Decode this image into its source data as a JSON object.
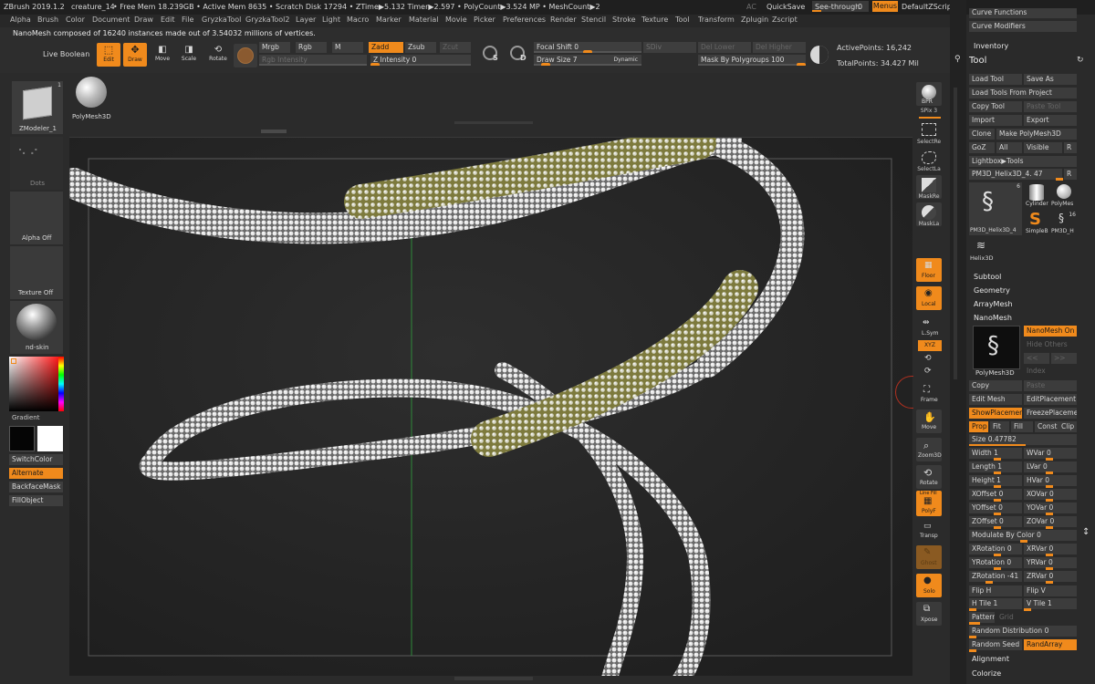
{
  "titlebar": {
    "app": "ZBrush 2019.1.2",
    "document": "creature_14",
    "stats": "• Free Mem 18.239GB • Active Mem 8635 • Scratch Disk 17294 • ZTime▶5.132 Timer▶2.597 • PolyCount▶3.524 MP • MeshCount▶2",
    "ac": "AC",
    "quicksave": "QuickSave",
    "seethrough": "See-through",
    "seethrough_value": "0",
    "menus": "Menus",
    "default_zscript": "DefaultZScript"
  },
  "menubar": [
    "Alpha",
    "Brush",
    "Color",
    "Document",
    "Draw",
    "Edit",
    "File",
    "GryzkaTool",
    "GryzkaTool2",
    "Layer",
    "Light",
    "Macro",
    "Marker",
    "Material",
    "Movie",
    "Picker",
    "Preferences",
    "Render",
    "Stencil",
    "Stroke",
    "Texture",
    "Tool",
    "Transform",
    "Zplugin",
    "Zscript"
  ],
  "notice": "NanoMesh composed of 16240 instances made out of 3.54032 millions of vertices.",
  "topshelf": {
    "live_boolean": "Live Boolean",
    "edit": "Edit",
    "draw": "Draw",
    "move": "Move",
    "scale": "Scale",
    "rotate": "Rotate",
    "mrgb": "Mrgb",
    "rgb": "Rgb",
    "m": "M",
    "zadd": "Zadd",
    "zsub": "Zsub",
    "zcut": "Zcut",
    "rgb_intensity": "Rgb Intensity",
    "z_intensity": "Z Intensity 0",
    "focal_shift": "Focal Shift 0",
    "draw_size": "Draw Size 7",
    "dynamic": "Dynamic",
    "sdiv": "SDiv",
    "del_lower": "Del Lower",
    "del_higher": "Del Higher",
    "mask_by_polygroups": "Mask By Polygroups 100",
    "active_points": "ActivePoints: 16,242",
    "total_points": "TotalPoints: 34.427 Mil"
  },
  "leftshelf": {
    "tool_label": "ZModeler_1",
    "polymesh_label": "PolyMesh3D",
    "dots": "Dots",
    "alpha_off": "Alpha Off",
    "texture_off": "Texture Off",
    "material": "nd-skin",
    "gradient": "Gradient",
    "switchcolor": "SwitchColor",
    "alternate": "Alternate",
    "backfacemask": "BackfaceMask",
    "fillobject": "FillObject",
    "tool_count": "1"
  },
  "rightshelf": {
    "bpr": "BPR",
    "spix": "SPix 3",
    "selectrect": "SelectRe",
    "selectlasso": "SelectLa",
    "maskrect": "MaskRe",
    "masklasso": "MaskLa",
    "floor": "Floor",
    "local": "Local",
    "lsym": "L.Sym",
    "xyz": "XYZ",
    "frame": "Frame",
    "move": "Move",
    "zoom3d": "Zoom3D",
    "rotate": "Rotate",
    "polyf": "PolyF",
    "linefill": "Line Fill",
    "transp": "Transp",
    "ghost": "Ghost",
    "solo": "Solo",
    "xpose": "Xpose"
  },
  "toolpanel": {
    "curve_functions": "Curve Functions",
    "curve_modifiers": "Curve Modifiers",
    "inventory": "Inventory",
    "tool_title": "Tool",
    "load_tool": "Load Tool",
    "save_as": "Save As",
    "load_from_project": "Load Tools From Project",
    "copy_tool": "Copy Tool",
    "paste_tool": "Paste Tool",
    "import": "Import",
    "export": "Export",
    "clone": "Clone",
    "make_polymesh": "Make PolyMesh3D",
    "goz": "GoZ",
    "all": "All",
    "visible": "Visible",
    "r": "R",
    "lightbox_tools": "Lightbox▶Tools",
    "current_tool": "PM3D_Helix3D_4. 47",
    "thumb_count": "6",
    "thumb_count2": "16",
    "thumbs": [
      "PM3D_Helix3D_4",
      "Cylinder",
      "PolyMes",
      "SimpleB",
      "PM3D_H",
      "Helix3D"
    ],
    "subtool": "Subtool",
    "geometry": "Geometry",
    "arraymesh": "ArrayMesh",
    "nanomesh": "NanoMesh",
    "nanomesh_on": "NanoMesh On",
    "hide_others": "Hide Others",
    "prev": "<<",
    "next": ">>",
    "index": "Index",
    "nm_thumb": "PolyMesh3D",
    "copy": "Copy",
    "paste": "Paste",
    "edit_mesh": "Edit Mesh",
    "edit_placement": "EditPlacement",
    "show_placement": "ShowPlacement",
    "freeze_placement": "FreezePlacemer",
    "prop": "Prop",
    "fit": "Fit",
    "fill": "Fill",
    "const": "Const",
    "clip": "Clip",
    "size": "Size 0.47782",
    "width": "Width 1",
    "wvar": "WVar 0",
    "length": "Length 1",
    "lvar": "LVar 0",
    "height": "Height 1",
    "hvar": "HVar 0",
    "xoffset": "XOffset 0",
    "xovar": "XOVar 0",
    "yoffset": "YOffset 0",
    "yovar": "YOVar 0",
    "zoffset": "ZOffset 0",
    "zovar": "ZOVar 0",
    "modulate_by_color": "Modulate By Color 0",
    "xrotation": "XRotation 0",
    "xrvar": "XRVar 0",
    "yrotation": "YRotation 0",
    "yrvar": "YRVar 0",
    "zrotation": "ZRotation -41",
    "zrvar": "ZRVar 0",
    "flip_h": "Flip H",
    "flip_v": "Flip V",
    "h_tile": "H Tile 1",
    "v_tile": "V Tile 1",
    "pattern": "Pattern",
    "grid": "Grid",
    "random_distribution": "Random Distribution 0",
    "random_seed": "Random Seed 0",
    "rand_array": "RandArray",
    "alignment": "Alignment",
    "colorize": "Colorize"
  },
  "colors": {
    "accent": "#f08a1c",
    "panel": "#2a2a2a",
    "viewport": "#272727"
  }
}
